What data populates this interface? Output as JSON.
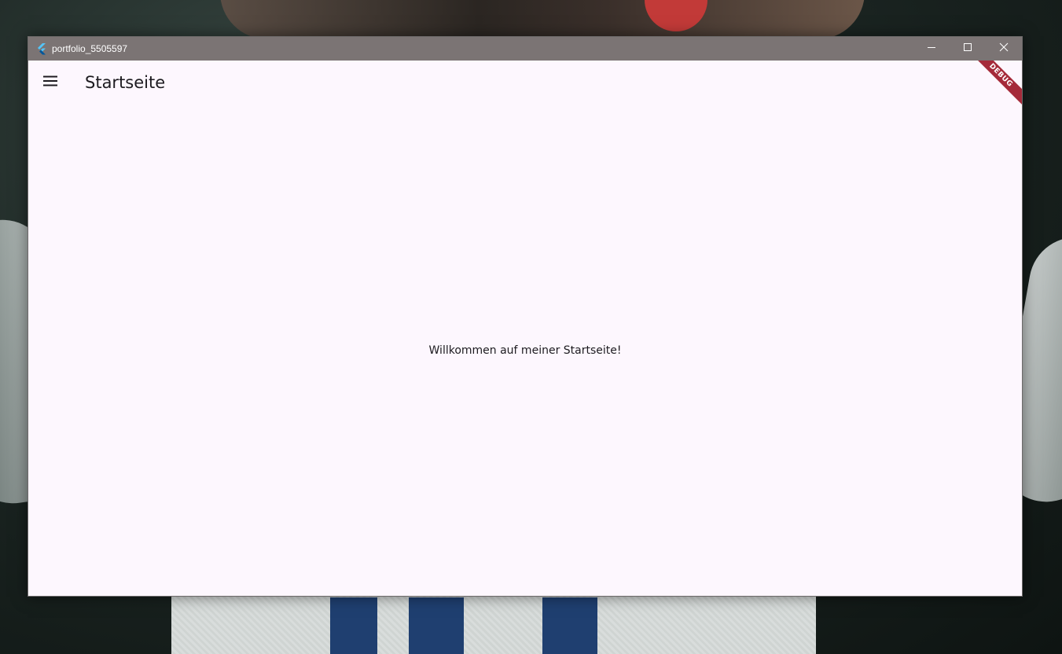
{
  "window": {
    "title": "portfolio_5505597",
    "app_icon": "flutter-icon",
    "controls": {
      "minimize_icon": "minimize-icon",
      "maximize_icon": "maximize-icon",
      "close_icon": "close-icon"
    }
  },
  "appbar": {
    "menu_icon": "hamburger-menu-icon",
    "title": "Startseite"
  },
  "body": {
    "welcome_text": "Willkommen auf meiner Startseite!"
  },
  "debug_banner": {
    "label": "DEBUG",
    "color": "#a52a3a"
  },
  "colors": {
    "titlebar": "#7b7474",
    "surface": "#fdf7fe",
    "text": "#1d1b20"
  }
}
